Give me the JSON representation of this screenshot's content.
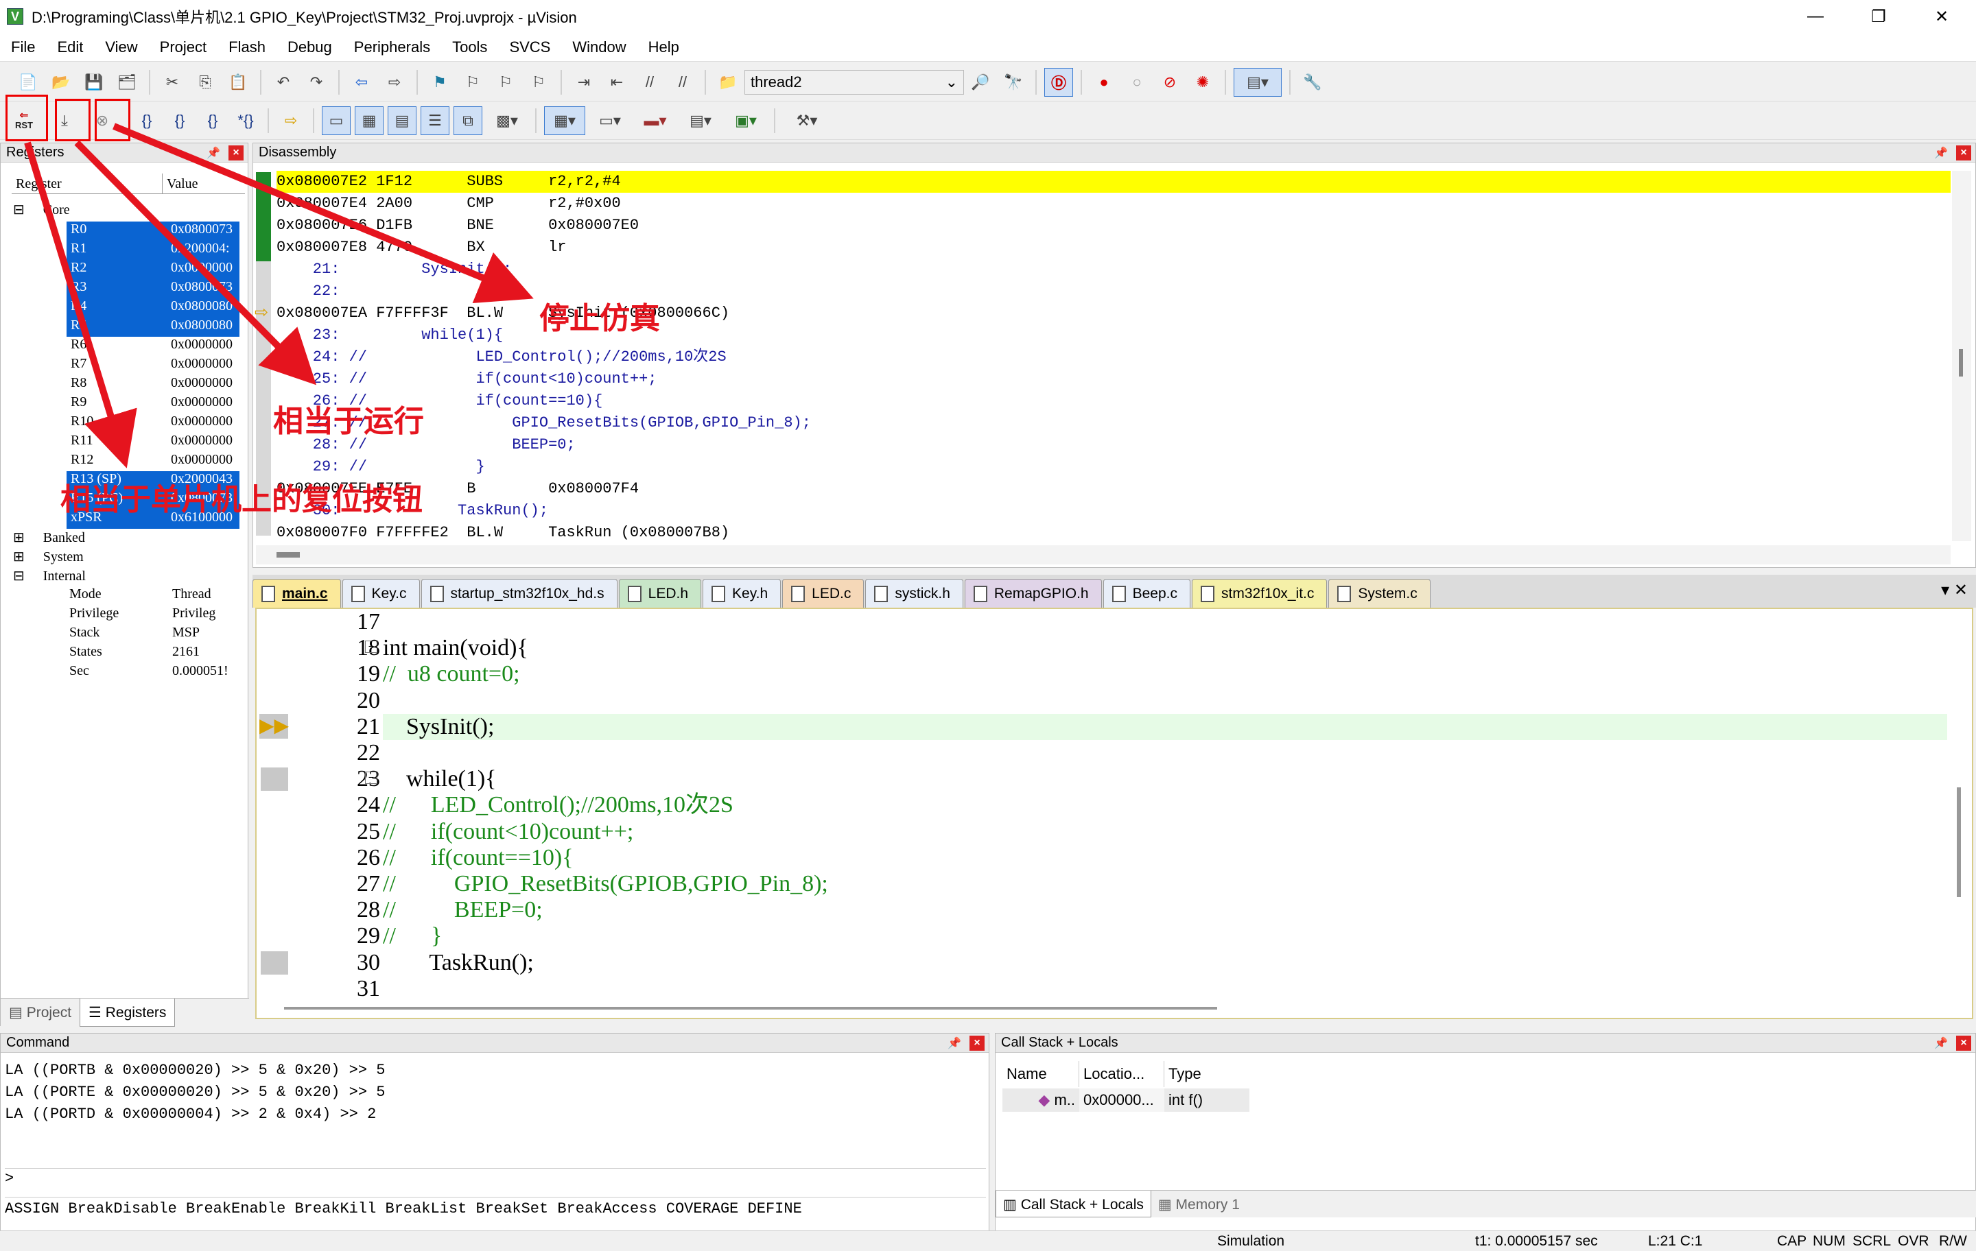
{
  "window": {
    "title": "D:\\Programing\\Class\\单片机\\2.1 GPIO_Key\\Project\\STM32_Proj.uvprojx - µVision",
    "minimize": "—",
    "maximize": "❐",
    "close": "✕"
  },
  "menu": [
    "File",
    "Edit",
    "View",
    "Project",
    "Flash",
    "Debug",
    "Peripherals",
    "Tools",
    "SVCS",
    "Window",
    "Help"
  ],
  "toolbar1": {
    "combo_value": "thread2"
  },
  "toolbar2": {
    "rst_label": "RST"
  },
  "registers": {
    "title": "Registers",
    "col_register": "Register",
    "col_value": "Value",
    "core_label": "Core",
    "rows": [
      {
        "name": "R0",
        "value": "0x0800073",
        "sel": true
      },
      {
        "name": "R1",
        "value": "0x200004:",
        "sel": true
      },
      {
        "name": "R2",
        "value": "0x0000000",
        "sel": true
      },
      {
        "name": "R3",
        "value": "0x0800073",
        "sel": true
      },
      {
        "name": "R4",
        "value": "0x0800080",
        "sel": true
      },
      {
        "name": "R5",
        "value": "0x0800080",
        "sel": true
      },
      {
        "name": "R6",
        "value": "0x0000000",
        "sel": false
      },
      {
        "name": "R7",
        "value": "0x0000000",
        "sel": false
      },
      {
        "name": "R8",
        "value": "0x0000000",
        "sel": false
      },
      {
        "name": "R9",
        "value": "0x0000000",
        "sel": false
      },
      {
        "name": "R10",
        "value": "0x0000000",
        "sel": false
      },
      {
        "name": "R11",
        "value": "0x0000000",
        "sel": false
      },
      {
        "name": "R12",
        "value": "0x0000000",
        "sel": false
      },
      {
        "name": "R13 (SP)",
        "value": "0x2000043",
        "sel": true
      },
      {
        "name": "R15 (PC)",
        "value": "0x0800073",
        "sel": true
      },
      {
        "name": "xPSR",
        "value": "0x6100000",
        "sel": true
      }
    ],
    "groups": [
      "Banked",
      "System",
      "Internal"
    ],
    "internal": [
      {
        "name": "Mode",
        "value": "Thread"
      },
      {
        "name": "Privilege",
        "value": "Privileg"
      },
      {
        "name": "Stack",
        "value": "MSP"
      },
      {
        "name": "States",
        "value": "2161"
      },
      {
        "name": "Sec",
        "value": "0.000051!"
      }
    ],
    "bottom_tabs": [
      "Project",
      "Registers"
    ]
  },
  "disassembly": {
    "title": "Disassembly",
    "lines": [
      {
        "text": "0x080007E2 1F12      SUBS     r2,r2,#4",
        "hl": true
      },
      {
        "text": "0x080007E4 2A00      CMP      r2,#0x00"
      },
      {
        "text": "0x080007E6 D1FB      BNE      0x080007E0"
      },
      {
        "text": "0x080007E8 4770      BX       lr"
      },
      {
        "text": "    21:         SysInit();"
      },
      {
        "text": "    22: "
      },
      {
        "text": "0x080007EA F7FFFF3F  BL.W     SysInit (0x0800066C)",
        "arrow": true
      },
      {
        "text": "    23:         while(1){"
      },
      {
        "text": "    24: //            LED_Control();//200ms,10次2S"
      },
      {
        "text": "    25: //            if(count<10)count++;"
      },
      {
        "text": "    26: //            if(count==10){"
      },
      {
        "text": "    27: //                GPIO_ResetBits(GPIOB,GPIO_Pin_8);"
      },
      {
        "text": "    28: //                BEEP=0;"
      },
      {
        "text": "    29: //            }"
      },
      {
        "text": "0x080007EE E7FE      B        0x080007F4"
      },
      {
        "text": "    30:             TaskRun();"
      },
      {
        "text": "0x080007F0 F7FFFFE2  BL.W     TaskRun (0x080007B8)"
      }
    ]
  },
  "file_tabs": [
    "main.c",
    "Key.c",
    "startup_stm32f10x_hd.s",
    "LED.h",
    "Key.h",
    "LED.c",
    "systick.h",
    "RemapGPIO.h",
    "Beep.c",
    "stm32f10x_it.c",
    "System.c"
  ],
  "editor": {
    "lines": [
      {
        "num": "17",
        "text": ""
      },
      {
        "num": "18",
        "text": "int main(void){"
      },
      {
        "num": "19",
        "text": "//  u8 count=0;"
      },
      {
        "num": "20",
        "text": ""
      },
      {
        "num": "21",
        "text": "    SysInit();"
      },
      {
        "num": "22",
        "text": ""
      },
      {
        "num": "23",
        "text": "    while(1){"
      },
      {
        "num": "24",
        "text": "//      LED_Control();//200ms,10次2S"
      },
      {
        "num": "25",
        "text": "//      if(count<10)count++;"
      },
      {
        "num": "26",
        "text": "//      if(count==10){"
      },
      {
        "num": "27",
        "text": "//          GPIO_ResetBits(GPIOB,GPIO_Pin_8);"
      },
      {
        "num": "28",
        "text": "//          BEEP=0;"
      },
      {
        "num": "29",
        "text": "//      }"
      },
      {
        "num": "30",
        "text": "        TaskRun();"
      },
      {
        "num": "31",
        "text": ""
      }
    ]
  },
  "command": {
    "title": "Command",
    "lines": [
      "LA ((PORTB & 0x00000020) >> 5 & 0x20) >> 5",
      "LA ((PORTE & 0x00000020) >> 5 & 0x20) >> 5",
      "LA ((PORTD & 0x00000004) >> 2 & 0x4) >> 2"
    ],
    "prompt": ">",
    "keywords": "ASSIGN BreakDisable BreakEnable BreakKill BreakList BreakSet BreakAccess COVERAGE DEFINE"
  },
  "callstack": {
    "title": "Call Stack + Locals",
    "col_name": "Name",
    "col_location": "Locatio...",
    "col_type": "Type",
    "row_name": "m..",
    "row_location": "0x00000...",
    "row_type": "int f()",
    "tab1": "Call Stack + Locals",
    "tab2": "Memory 1"
  },
  "status": {
    "mode": "Simulation",
    "time": "t1: 0.00005157 sec",
    "pos": "L:21 C:1",
    "caps": "CAP",
    "num": "NUM",
    "scrl": "SCRL",
    "ovr": "OVR",
    "rw": "R/W"
  },
  "annotations": {
    "stop": "停止仿真",
    "run": "相当于运行",
    "reset": "相当于单片机上的复位按钮"
  },
  "colors": {
    "highlight": "#ffff00",
    "selection": "#0a64d2",
    "annotation": "#e5141e",
    "comment": "#1a8a1a",
    "keyword": "#1010c8"
  }
}
